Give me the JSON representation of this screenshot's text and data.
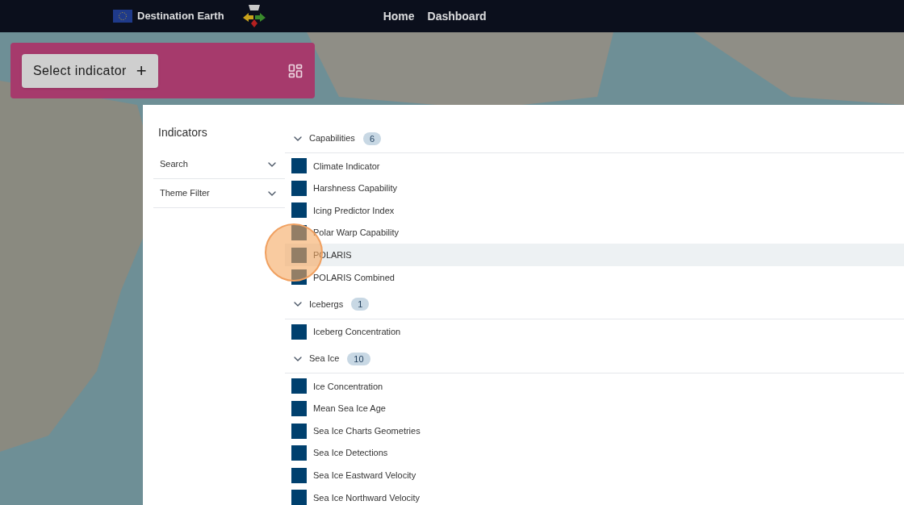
{
  "header": {
    "brand": "Destination Earth",
    "nav": [
      {
        "label": "Home"
      },
      {
        "label": "Dashboard"
      }
    ]
  },
  "toolbar": {
    "button": "Select indicator",
    "button_icon": "+"
  },
  "sidebar": {
    "title": "Indicators",
    "filters": [
      {
        "label": "Search"
      },
      {
        "label": "Theme Filter"
      }
    ]
  },
  "groups": [
    {
      "name": "Capabilities",
      "count": "6",
      "expanded": true,
      "items": [
        {
          "label": "Climate Indicator",
          "highlighted": false
        },
        {
          "label": "Harshness Capability",
          "highlighted": false
        },
        {
          "label": "Icing Predictor Index",
          "highlighted": false
        },
        {
          "label": "Polar Warp Capability",
          "highlighted": false
        },
        {
          "label": "POLARIS",
          "highlighted": true
        },
        {
          "label": "POLARIS Combined",
          "highlighted": false
        }
      ]
    },
    {
      "name": "Icebergs",
      "count": "1",
      "expanded": true,
      "items": [
        {
          "label": "Iceberg Concentration",
          "highlighted": false
        }
      ]
    },
    {
      "name": "Sea Ice",
      "count": "10",
      "expanded": true,
      "items": [
        {
          "label": "Ice Concentration",
          "highlighted": false
        },
        {
          "label": "Mean Sea Ice Age",
          "highlighted": false
        },
        {
          "label": "Sea Ice Charts Geometries",
          "highlighted": false
        },
        {
          "label": "Sea Ice Detections",
          "highlighted": false
        },
        {
          "label": "Sea Ice Eastward Velocity",
          "highlighted": false
        },
        {
          "label": "Sea Ice Northward Velocity",
          "highlighted": false
        }
      ]
    }
  ]
}
